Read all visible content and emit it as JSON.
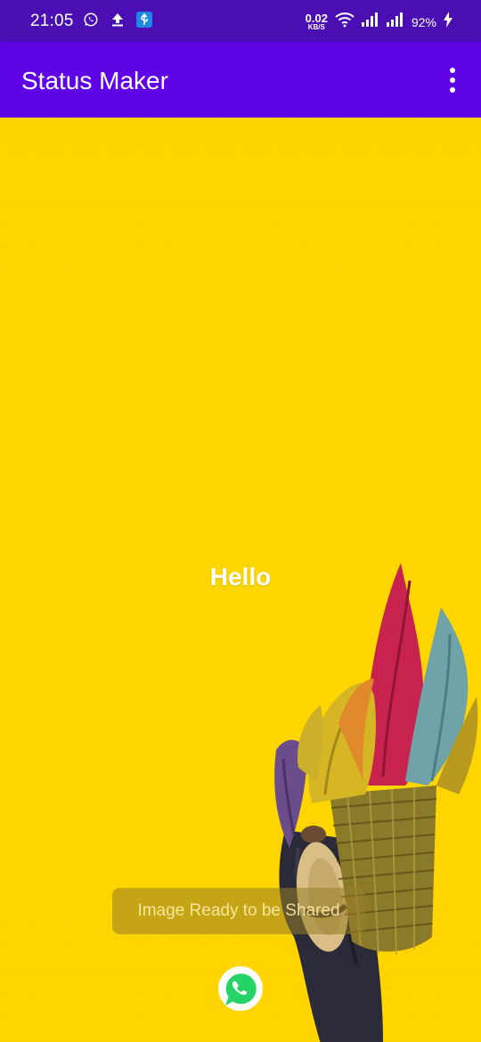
{
  "status_bar": {
    "time": "21:05",
    "network_speed": "0.02",
    "network_speed_unit": "KB/S",
    "battery": "92%",
    "icons": [
      "whatsapp-icon",
      "upload-icon",
      "usb-icon",
      "wifi-icon",
      "signal-icon",
      "signal-icon",
      "charging-icon"
    ]
  },
  "app_bar": {
    "title": "Status Maker",
    "overflow_icon": "more-vert-icon"
  },
  "canvas": {
    "text": "Hello",
    "background_color": "#ffd400"
  },
  "toast": {
    "message": "Image Ready to be Shared"
  },
  "share_button": {
    "icon": "whatsapp-icon",
    "color": "#25d366"
  },
  "colors": {
    "status_bar": "#4a0fb3",
    "app_bar": "#5f04e6"
  }
}
